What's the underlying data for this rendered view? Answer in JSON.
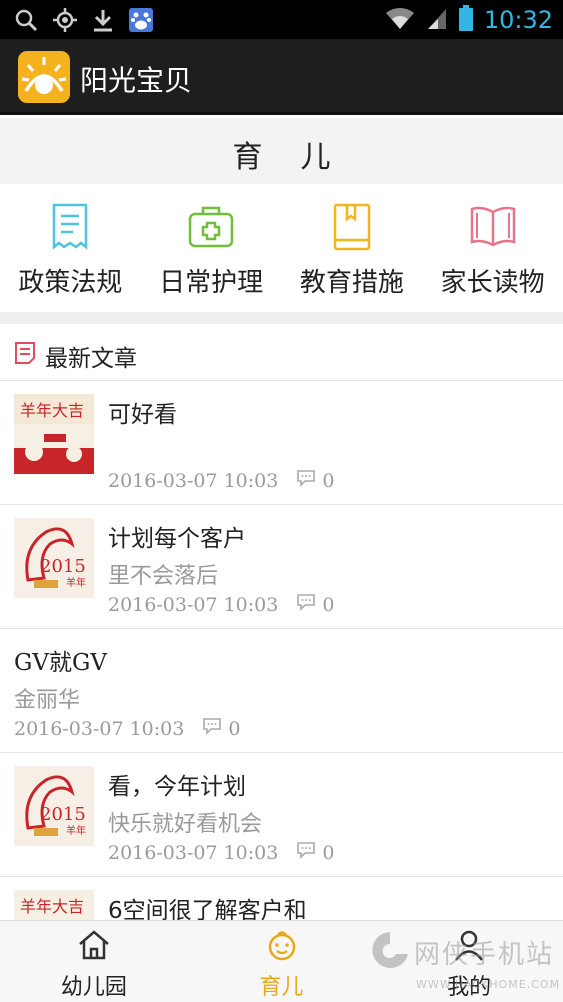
{
  "status_bar": {
    "time": "10:32",
    "left_icons": [
      "search-icon",
      "gps-icon",
      "download-icon",
      "baidu-icon"
    ],
    "right_icons": [
      "wifi-icon",
      "signal-icon",
      "battery-icon"
    ]
  },
  "app_bar": {
    "title": "阳光宝贝",
    "logo": "sun-logo-icon"
  },
  "page": {
    "title": "育儿"
  },
  "categories": [
    {
      "label": "政策法规",
      "icon": "document-icon",
      "color": "#4ec3d9"
    },
    {
      "label": "日常护理",
      "icon": "first-aid-kit-icon",
      "color": "#6fbf3a"
    },
    {
      "label": "教育措施",
      "icon": "book-icon",
      "color": "#f2b51c"
    },
    {
      "label": "家长读物",
      "icon": "open-book-icon",
      "color": "#e8748c"
    }
  ],
  "section": {
    "title": "最新文章",
    "icon": "article-list-icon",
    "icon_color": "#e24c5c"
  },
  "articles": [
    {
      "title": "可好看",
      "subtitle": "",
      "date": "2016-03-07  10:03",
      "comments": "0",
      "thumbnail": "new-year-banner"
    },
    {
      "title": "计划每个客户",
      "subtitle": "里不会落后",
      "date": "2016-03-07  10:03",
      "comments": "0",
      "thumbnail": "year-of-goat-2015"
    },
    {
      "title": "GV就GV",
      "subtitle": "金丽华",
      "date": "2016-03-07  10:03",
      "comments": "0",
      "thumbnail": ""
    },
    {
      "title": "看，今年计划",
      "subtitle": "快乐就好看机会",
      "date": "2016-03-07  10:03",
      "comments": "0",
      "thumbnail": "year-of-goat-2015"
    },
    {
      "title": "6空间很了解客户和",
      "subtitle": "",
      "date": "",
      "comments": "",
      "thumbnail": "new-year-banner"
    }
  ],
  "tabs": [
    {
      "label": "幼儿园",
      "icon": "home-icon",
      "active": false
    },
    {
      "label": "育儿",
      "icon": "baby-face-icon",
      "active": true
    },
    {
      "label": "我的",
      "icon": "person-icon",
      "active": false
    }
  ],
  "watermark": {
    "text": "网侠手机站",
    "url": "WWW.HACKHOME.COM"
  },
  "colors": {
    "accent": "#e8a81c",
    "app_bar": "#1e1e1e",
    "status_time": "#33b5e5"
  }
}
